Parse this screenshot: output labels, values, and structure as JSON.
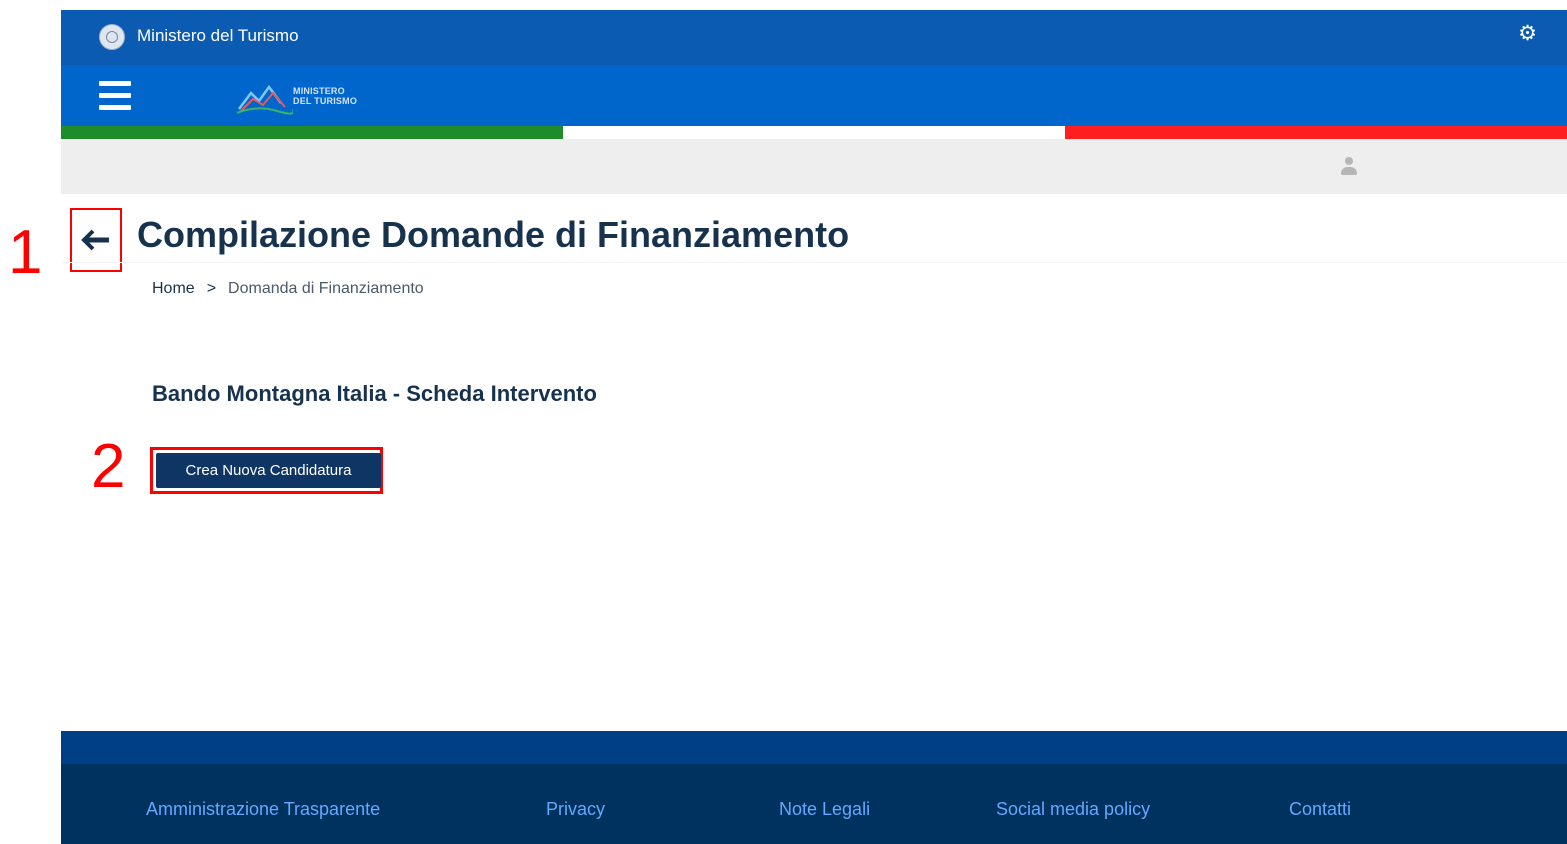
{
  "topbar": {
    "ministry_name": "Ministero del Turismo",
    "settings_icon": "gear-icon"
  },
  "header": {
    "menu_icon": "hamburger-icon",
    "logo": {
      "line1": "MINISTERO",
      "line2": "DEL TURISMO"
    }
  },
  "flag_colors": [
    "#1e8c2b",
    "#ffffff",
    "#ff1f1f"
  ],
  "userbar": {
    "avatar_icon": "user-icon"
  },
  "page": {
    "back_icon": "arrow-left-icon",
    "title": "Compilazione Domande di Finanziamento",
    "breadcrumb": {
      "home": "Home",
      "separator": ">",
      "current": "Domanda di Finanziamento"
    },
    "section_title": "Bando Montagna Italia - Scheda Intervento",
    "create_button": "Crea Nuova Candidatura"
  },
  "annotations": {
    "callout_1": "1",
    "callout_2": "2",
    "color": "#ff0000"
  },
  "footer": {
    "links": [
      "Amministrazione Trasparente",
      "Privacy",
      "Note Legali",
      "Social media policy",
      "Contatti"
    ]
  },
  "colors": {
    "primary": "#0066cc",
    "dark": "#0b5bb2",
    "title": "#17324d",
    "footer": "#00325f",
    "button": "#0e3563"
  }
}
